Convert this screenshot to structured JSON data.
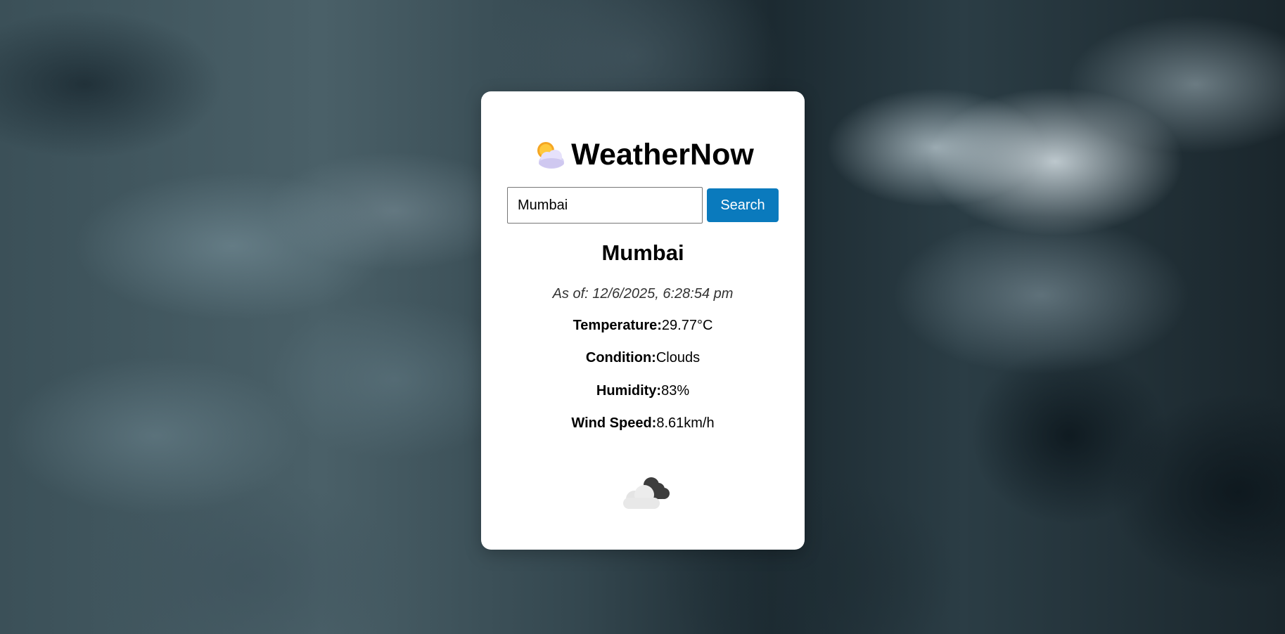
{
  "app": {
    "title": "WeatherNow",
    "logo_icon": "sun-behind-cloud-icon"
  },
  "search": {
    "value": "Mumbai",
    "button_label": "Search"
  },
  "weather": {
    "city": "Mumbai",
    "as_of": "As of: 12/6/2025, 6:28:54 pm",
    "stats": [
      {
        "label": "Temperature:",
        "value": "29.77°C"
      },
      {
        "label": "Condition:",
        "value": "Clouds"
      },
      {
        "label": "Humidity:",
        "value": "83%"
      },
      {
        "label": "Wind Speed:",
        "value": "8.61km/h"
      }
    ],
    "condition_icon": "broken-clouds-icon"
  },
  "colors": {
    "button_bg": "#0a7abd",
    "card_bg": "#ffffff",
    "background": "#1f2e36"
  }
}
